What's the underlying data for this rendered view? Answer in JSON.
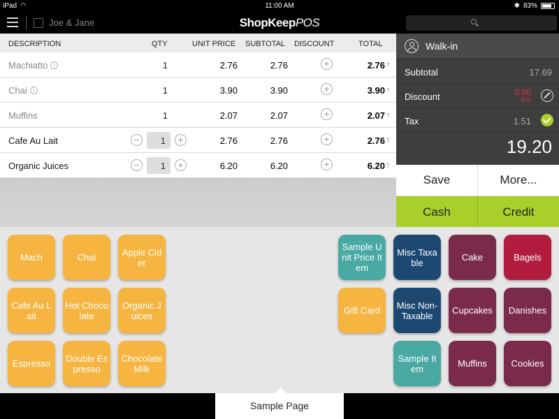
{
  "status": {
    "device": "iPad",
    "time": "11:00 AM",
    "battery": "83%",
    "battery_level": 0.83
  },
  "header": {
    "customer_name": "Joe & Jane",
    "brand_main": "ShopKeep",
    "brand_suffix": "POS"
  },
  "order": {
    "columns": [
      "DESCRIPTION",
      "QTY",
      "UNIT PRICE",
      "SUBTOTAL",
      "DISCOUNT",
      "TOTAL"
    ],
    "rows": [
      {
        "description": "Machiatto",
        "qty": "1",
        "unit_price": "2.76",
        "subtotal": "2.76",
        "total": "2.76",
        "tax_mark": "T"
      },
      {
        "description": "Chai",
        "qty": "1",
        "unit_price": "3.90",
        "subtotal": "3.90",
        "total": "3.90",
        "tax_mark": "T"
      },
      {
        "description": "Muffins",
        "qty": "1",
        "unit_price": "2.07",
        "subtotal": "2.07",
        "total": "2.07",
        "tax_mark": "T"
      },
      {
        "description": "Cafe Au Lait",
        "qty": "1",
        "unit_price": "2.76",
        "subtotal": "2.76",
        "total": "2.76",
        "tax_mark": "T"
      },
      {
        "description": "Organic Juices",
        "qty": "1",
        "unit_price": "6.20",
        "subtotal": "6.20",
        "total": "6.20",
        "tax_mark": "T"
      }
    ]
  },
  "summary": {
    "customer": "Walk-in",
    "subtotal_label": "Subtotal",
    "subtotal": "17.69",
    "discount_label": "Discount",
    "discount": "0.00",
    "discount_pct": "0%",
    "tax_label": "Tax",
    "tax": "1.51",
    "grand_total": "19.20"
  },
  "actions": {
    "save": "Save",
    "more": "More...",
    "cash": "Cash",
    "credit": "Credit"
  },
  "colors": {
    "orange": "#f5b540",
    "teal": "#4aa9a3",
    "navy": "#1c4872",
    "maroon": "#7a2b4a",
    "red": "#b21d3f",
    "green": "#a9cf2b"
  },
  "items": [
    {
      "label": "Mach",
      "color": "orange"
    },
    {
      "label": "Chai",
      "color": "orange"
    },
    {
      "label": "Apple Cider",
      "color": "orange"
    },
    {
      "label": "Cafe Au Lait",
      "color": "orange"
    },
    {
      "label": "Hot Chocolate",
      "color": "orange"
    },
    {
      "label": "Organic Juices",
      "color": "orange"
    },
    {
      "label": "Espresso",
      "color": "orange"
    },
    {
      "label": "Double Espresso",
      "color": "orange"
    },
    {
      "label": "Chocolate Milk",
      "color": "orange"
    },
    {
      "label": "Sample Unit Price Item",
      "color": "teal"
    },
    {
      "label": "Misc Taxable",
      "color": "navy"
    },
    {
      "label": "Cake",
      "color": "maroon"
    },
    {
      "label": "Bagels",
      "color": "red"
    },
    {
      "label": "Gift Card",
      "color": "orange"
    },
    {
      "label": "Misc Non-Taxable",
      "color": "navy"
    },
    {
      "label": "Cupcakes",
      "color": "maroon"
    },
    {
      "label": "Danishes",
      "color": "maroon"
    },
    {
      "label": "Sample Item",
      "color": "teal"
    },
    {
      "label": "Muffins",
      "color": "maroon"
    },
    {
      "label": "Cookies",
      "color": "maroon"
    }
  ],
  "page_tab": "Sample Page"
}
